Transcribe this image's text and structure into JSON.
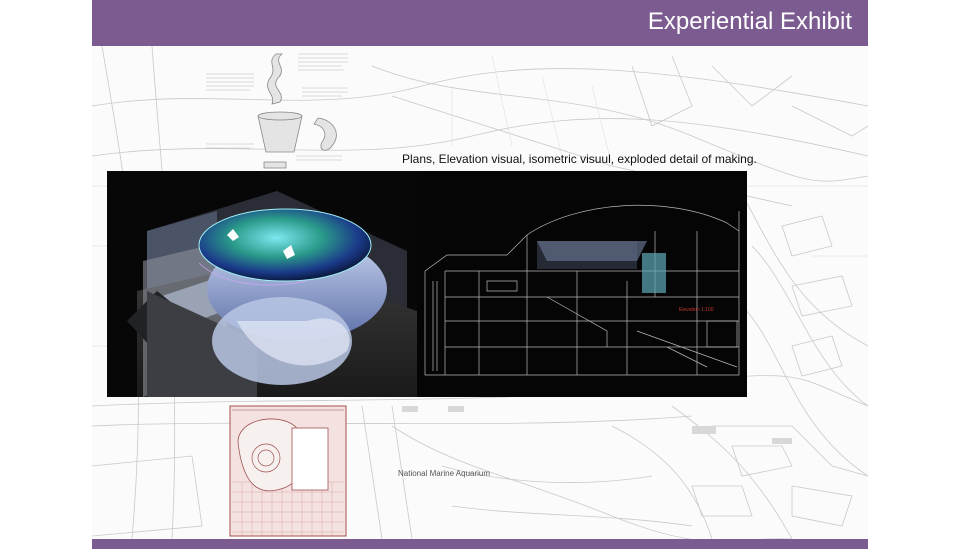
{
  "slide": {
    "title": "Experiential Exhibit",
    "caption": "Plans, Elevation visual, isometric visuul, exploded detail of making.",
    "colors": {
      "accent": "#7c5b91",
      "background": "#ffffff"
    }
  },
  "map": {
    "aquarium_label": "National Marine Aquarium"
  }
}
